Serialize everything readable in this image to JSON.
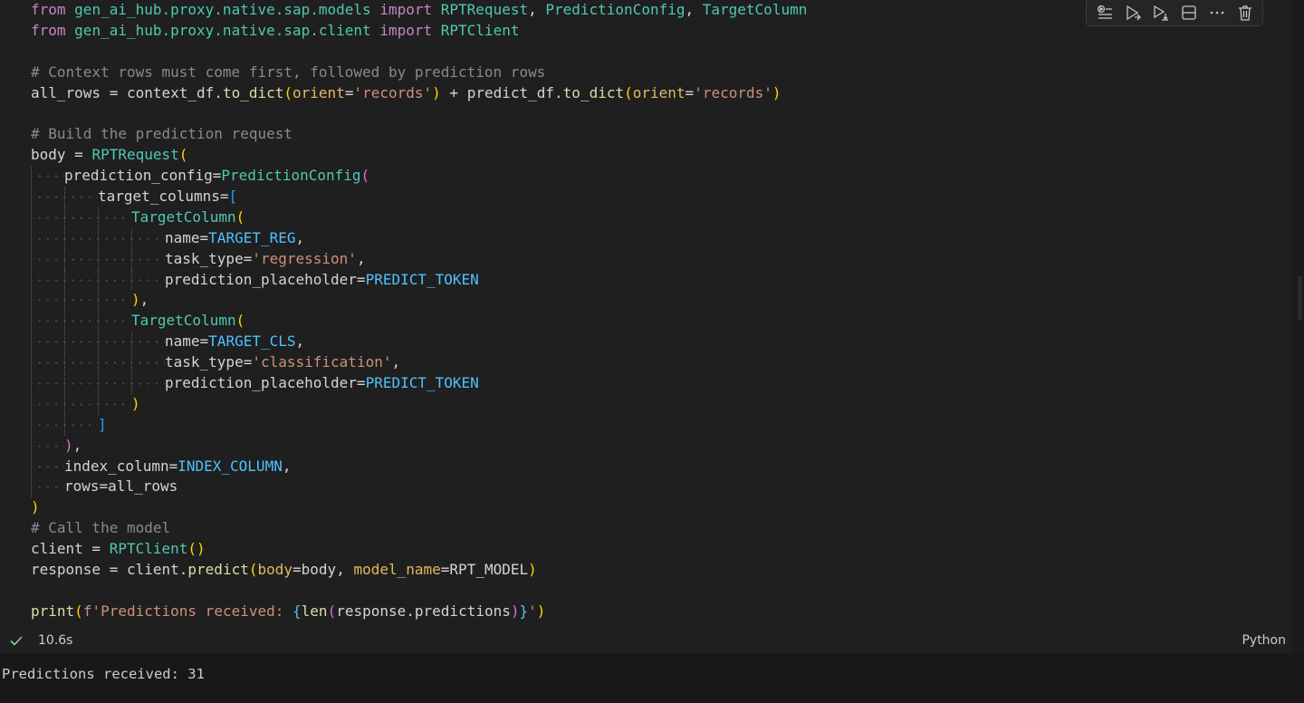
{
  "code": {
    "line1": {
      "from": "from",
      "module": "gen_ai_hub.proxy.native.sap.models",
      "import": "import",
      "c1": "RPTRequest",
      "sep1": ", ",
      "c2": "PredictionConfig",
      "sep2": ", ",
      "c3": "TargetColumn"
    },
    "line2": {
      "from": "from",
      "module": "gen_ai_hub.proxy.native.sap.client",
      "import": "import",
      "c1": "RPTClient"
    },
    "line4": {
      "comment": "# Context rows must come first, followed by prediction rows"
    },
    "line5": {
      "var": "all_rows",
      "eq": " = ",
      "obj1": "context_df",
      "dot1": ".",
      "fn1": "to_dict",
      "p1o": "(",
      "arg1": "orient",
      "eq1": "=",
      "str1": "'records'",
      "p1c": ")",
      "plus": " + ",
      "obj2": "predict_df",
      "dot2": ".",
      "fn2": "to_dict",
      "p2o": "(",
      "arg2": "orient",
      "eq2": "=",
      "str2": "'records'",
      "p2c": ")"
    },
    "line7": {
      "comment": "# Build the prediction request"
    },
    "line8": {
      "var": "body",
      "eq": " = ",
      "cls": "RPTRequest",
      "p": "("
    },
    "line9": {
      "kw": "prediction_config",
      "eq": "=",
      "cls": "PredictionConfig",
      "p": "("
    },
    "line10": {
      "kw": "target_columns",
      "eq": "=",
      "p": "["
    },
    "line11": {
      "cls": "TargetColumn",
      "p": "("
    },
    "line12": {
      "kw": "name",
      "eq": "=",
      "val": "TARGET_REG",
      "tail": ","
    },
    "line13": {
      "kw": "task_type",
      "eq": "=",
      "val": "'regression'",
      "tail": ","
    },
    "line14": {
      "kw": "prediction_placeholder",
      "eq": "=",
      "val": "PREDICT_TOKEN"
    },
    "line15": {
      "p": ")",
      "tail": ","
    },
    "line16": {
      "cls": "TargetColumn",
      "p": "("
    },
    "line17": {
      "kw": "name",
      "eq": "=",
      "val": "TARGET_CLS",
      "tail": ","
    },
    "line18": {
      "kw": "task_type",
      "eq": "=",
      "val": "'classification'",
      "tail": ","
    },
    "line19": {
      "kw": "prediction_placeholder",
      "eq": "=",
      "val": "PREDICT_TOKEN"
    },
    "line20": {
      "p": ")"
    },
    "line21": {
      "p": "]"
    },
    "line22": {
      "p": ")",
      "tail": ","
    },
    "line23": {
      "kw": "index_column",
      "eq": "=",
      "val": "INDEX_COLUMN",
      "tail": ","
    },
    "line24": {
      "kw": "rows",
      "eq": "=",
      "val": "all_rows"
    },
    "line25": {
      "p": ")"
    },
    "line26": {
      "comment": "# Call the model"
    },
    "line27": {
      "var": "client",
      "eq": " = ",
      "cls": "RPTClient",
      "p": "()"
    },
    "line28": {
      "var": "response",
      "eq": " = ",
      "obj": "client",
      "dot": ".",
      "fn": "predict",
      "po": "(",
      "arg1": "body",
      "eq1": "=",
      "val1": "body",
      "sep": ", ",
      "arg2": "model_name",
      "eq2": "=",
      "val2": "RPT_MODEL",
      "pc": ")"
    },
    "line30": {
      "fn": "print",
      "po": "(",
      "fprefix": "f",
      "str": "'Predictions received: ",
      "bo": "{",
      "fn2": "len",
      "p2o": "(",
      "expr": "response.predictions",
      "p2c": ")",
      "bc": "}",
      "strend": "'",
      "pc": ")"
    }
  },
  "status": {
    "exec_time": "10.6s",
    "language": "Python"
  },
  "output": {
    "text": "Predictions received: 31"
  },
  "toolbar": {
    "icons": [
      "execute-above-icon",
      "run-cell-icon",
      "run-below-icon",
      "split-cell-icon",
      "more-icon",
      "delete-icon"
    ]
  },
  "colors": {
    "keyword": "#c586c0",
    "class": "#4ec9b0",
    "string": "#ce9178",
    "comment": "#8a8a8a",
    "constant": "#4fc1ff",
    "param": "#e5b85f",
    "success": "#89d185"
  }
}
